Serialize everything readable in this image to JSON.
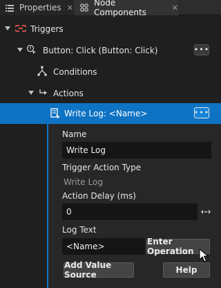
{
  "tabs": [
    {
      "label": "Properties",
      "close": "✕"
    },
    {
      "label": "Node Components",
      "close": "✕"
    }
  ],
  "tree": {
    "triggers_label": "Triggers",
    "button_click_label": "Button: Click (Button: Click)",
    "conditions_label": "Conditions",
    "actions_label": "Actions",
    "write_log_label": "Write Log: <Name>",
    "more_label": "•••"
  },
  "form": {
    "name_label": "Name",
    "name_value": "Write Log",
    "type_label": "Trigger Action Type",
    "type_value": "Write Log",
    "delay_label": "Action Delay (ms)",
    "delay_value": "0",
    "logtext_label": "Log Text",
    "logtext_value": "<Name>",
    "enter_operation_label": "Enter Operation",
    "add_value_source_label": "Add Value Source",
    "help_label": "Help"
  },
  "colors": {
    "selection": "#0f73c4",
    "trigger_icon": "#e0554f"
  }
}
